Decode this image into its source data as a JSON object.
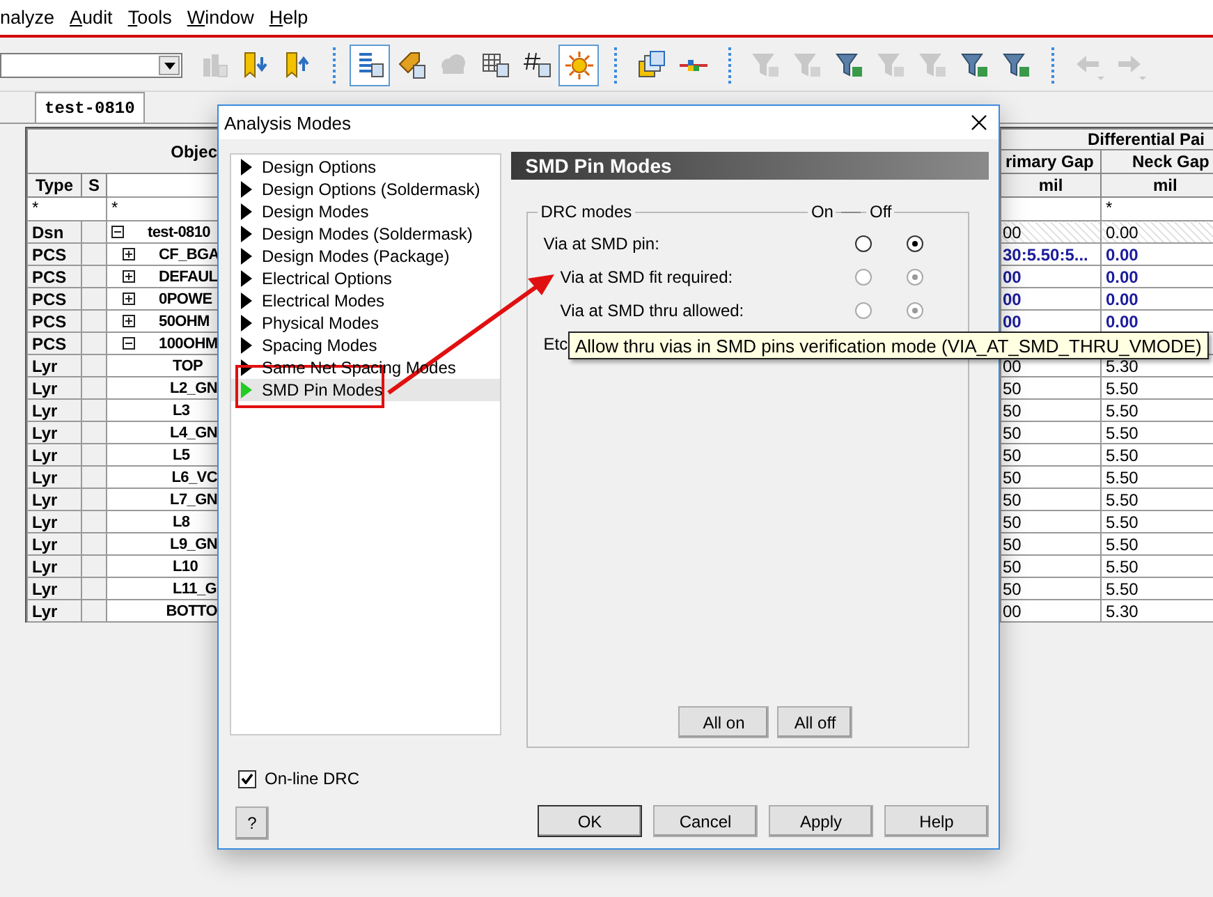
{
  "menu_bar": [
    {
      "label": "nalyze",
      "accelerator": false
    },
    {
      "label": "Audit",
      "accelerator": true
    },
    {
      "label": "Tools",
      "accelerator": true
    },
    {
      "label": "Window",
      "accelerator": true
    },
    {
      "label": "Help",
      "accelerator": true
    }
  ],
  "toolbar": [
    {
      "kind": "buildings",
      "disabled": true,
      "pressed": false,
      "separator_before": false
    },
    {
      "kind": "bookmark-down",
      "disabled": false,
      "pressed": false,
      "separator_before": false
    },
    {
      "kind": "bookmark-up",
      "disabled": false,
      "pressed": false,
      "separator_before": false
    },
    {
      "kind": "list",
      "disabled": false,
      "pressed": true,
      "separator_before": true
    },
    {
      "kind": "tag",
      "disabled": false,
      "pressed": false,
      "separator_before": false
    },
    {
      "kind": "cloud",
      "disabled": true,
      "pressed": false,
      "separator_before": false
    },
    {
      "kind": "grid",
      "disabled": false,
      "pressed": false,
      "separator_before": false
    },
    {
      "kind": "hash",
      "disabled": false,
      "pressed": false,
      "separator_before": false
    },
    {
      "kind": "sun",
      "disabled": false,
      "pressed": true,
      "separator_before": false
    },
    {
      "kind": "windows",
      "disabled": false,
      "pressed": false,
      "separator_before": true
    },
    {
      "kind": "connector",
      "disabled": false,
      "pressed": false,
      "separator_before": false
    },
    {
      "kind": "filter",
      "disabled": true,
      "pressed": false,
      "separator_before": true
    },
    {
      "kind": "filter",
      "disabled": true,
      "pressed": false,
      "separator_before": false
    },
    {
      "kind": "filter",
      "disabled": false,
      "pressed": false,
      "separator_before": false
    },
    {
      "kind": "filter",
      "disabled": true,
      "pressed": false,
      "separator_before": false
    },
    {
      "kind": "filter",
      "disabled": true,
      "pressed": false,
      "separator_before": false
    },
    {
      "kind": "filter",
      "disabled": false,
      "pressed": false,
      "separator_before": false
    },
    {
      "kind": "filter",
      "disabled": false,
      "pressed": false,
      "separator_before": false
    },
    {
      "kind": "arrow-left",
      "disabled": true,
      "pressed": false,
      "separator_before": true
    },
    {
      "kind": "arrow-right",
      "disabled": true,
      "pressed": false,
      "separator_before": false
    }
  ],
  "document_tab": {
    "label": "test-0810"
  },
  "table": {
    "left": {
      "header": "Objec",
      "columns": [
        "Type",
        "S"
      ],
      "type_filter": "*",
      "object_filter": "*"
    },
    "right": {
      "group": "Differential Pai",
      "columns": [
        "rimary Gap",
        "Neck Gap"
      ],
      "units": [
        "mil",
        "mil"
      ],
      "neck_gap_filter": "*"
    },
    "rows": [
      {
        "type": "Dsn",
        "kind": "design",
        "name": "test-0810",
        "expanded": true,
        "primary_gap": "00",
        "neck_gap": "0.00",
        "children": [
          {
            "type": "PCS",
            "kind": "set",
            "name": "CF_BGA",
            "expanded": false,
            "primary_gap": "30:5.50:5...",
            "neck_gap": "0.00"
          },
          {
            "type": "PCS",
            "kind": "set",
            "name": "DEFAUL",
            "expanded": false,
            "primary_gap": "00",
            "neck_gap": "0.00"
          },
          {
            "type": "PCS",
            "kind": "set",
            "name": "0POWE",
            "expanded": false,
            "primary_gap": "00",
            "neck_gap": "0.00"
          },
          {
            "type": "PCS",
            "kind": "set",
            "name": "50OHM",
            "expanded": false,
            "primary_gap": "00",
            "neck_gap": "0.00"
          },
          {
            "type": "PCS",
            "kind": "set",
            "name": "100OHM",
            "expanded": true,
            "children": [
              {
                "type": "Lyr",
                "name": "TOP",
                "primary_gap": "00",
                "neck_gap": "5.30"
              },
              {
                "type": "Lyr",
                "name": "L2_GN",
                "primary_gap": "50",
                "neck_gap": "5.50"
              },
              {
                "type": "Lyr",
                "name": "L3",
                "primary_gap": "50",
                "neck_gap": "5.50"
              },
              {
                "type": "Lyr",
                "name": "L4_GN",
                "primary_gap": "50",
                "neck_gap": "5.50"
              },
              {
                "type": "Lyr",
                "name": "L5",
                "primary_gap": "50",
                "neck_gap": "5.50"
              },
              {
                "type": "Lyr",
                "name": "L6_VC",
                "primary_gap": "50",
                "neck_gap": "5.50"
              },
              {
                "type": "Lyr",
                "name": "L7_GN",
                "primary_gap": "50",
                "neck_gap": "5.50"
              },
              {
                "type": "Lyr",
                "name": "L8",
                "primary_gap": "50",
                "neck_gap": "5.50"
              },
              {
                "type": "Lyr",
                "name": "L9_GN",
                "primary_gap": "50",
                "neck_gap": "5.50"
              },
              {
                "type": "Lyr",
                "name": "L10",
                "primary_gap": "50",
                "neck_gap": "5.50"
              },
              {
                "type": "Lyr",
                "name": "L11_G",
                "primary_gap": "50",
                "neck_gap": "5.50"
              },
              {
                "type": "Lyr",
                "name": "BOTTO",
                "primary_gap": "00",
                "neck_gap": "5.30"
              }
            ]
          }
        ]
      }
    ]
  },
  "dialog": {
    "title": "Analysis Modes",
    "tree": [
      {
        "label": "Design Options",
        "selected": false
      },
      {
        "label": "Design Options (Soldermask)",
        "selected": false
      },
      {
        "label": "Design Modes",
        "selected": false
      },
      {
        "label": "Design Modes (Soldermask)",
        "selected": false
      },
      {
        "label": "Design Modes (Package)",
        "selected": false
      },
      {
        "label": "Electrical Options",
        "selected": false
      },
      {
        "label": "Electrical Modes",
        "selected": false
      },
      {
        "label": "Physical Modes",
        "selected": false
      },
      {
        "label": "Spacing Modes",
        "selected": false
      },
      {
        "label": "Same Net Spacing Modes",
        "selected": false
      },
      {
        "label": "SMD Pin Modes",
        "selected": true
      }
    ],
    "panel": {
      "title": "SMD Pin Modes",
      "group": "DRC modes",
      "on_label": "On",
      "off_label": "Off",
      "modes": [
        {
          "label": "Via at SMD pin:",
          "on": false,
          "disabled": false,
          "children": [
            {
              "label": "Via at SMD fit required:",
              "on": false,
              "disabled": true
            },
            {
              "label": "Via at SMD thru allowed:",
              "on": false,
              "disabled": true
            }
          ]
        },
        {
          "label": "Etc"
        }
      ],
      "buttons": [
        "All on",
        "All off"
      ]
    },
    "online_drc": {
      "label": "On-line DRC",
      "checked": true
    },
    "help_key": "?",
    "buttons": [
      {
        "label": "OK",
        "default": true
      },
      {
        "label": "Cancel",
        "default": false
      },
      {
        "label": "Apply",
        "default": false
      },
      {
        "label": "Help",
        "default": false
      }
    ]
  },
  "tooltip": {
    "text": "Allow thru vias in SMD pins verification mode (VIA_AT_SMD_THRU_VMODE)"
  }
}
